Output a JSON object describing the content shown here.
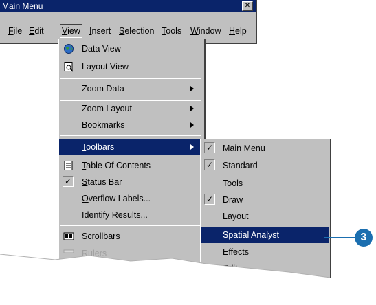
{
  "window": {
    "title": "Main Menu",
    "close_glyph": "✕"
  },
  "menubar": [
    {
      "label": "File",
      "u": "F",
      "rest": "ile"
    },
    {
      "label": "Edit",
      "u": "E",
      "rest": "dit"
    },
    {
      "label": "View",
      "u": "V",
      "rest": "iew"
    },
    {
      "label": "Insert",
      "u": "I",
      "rest": "nsert"
    },
    {
      "label": "Selection",
      "u": "S",
      "rest": "election"
    },
    {
      "label": "Tools",
      "u": "T",
      "rest": "ools"
    },
    {
      "label": "Window",
      "u": "W",
      "rest": "indow"
    },
    {
      "label": "Help",
      "u": "H",
      "rest": "elp"
    }
  ],
  "view_menu": {
    "data_view": "Data View",
    "layout_view": "Layout View",
    "zoom_data": "Zoom Data",
    "zoom_layout": "Zoom Layout",
    "bookmarks": "Bookmarks",
    "toolbars_u": "T",
    "toolbars_rest": "oolbars",
    "toc_u": "T",
    "toc_rest": "able Of Contents",
    "status_u": "S",
    "status_rest": "tatus Bar",
    "overflow_u": "O",
    "overflow_rest": "verflow Labels...",
    "identify": "Identify Results...",
    "scrollbars": "Scrollbars",
    "rulers": "Rulers"
  },
  "toolbars_menu": {
    "main_menu": "Main Menu",
    "standard": "Standard",
    "tools": "Tools",
    "draw": "Draw",
    "layout": "Layout",
    "spatial_analyst": "Spatial Analyst",
    "effects": "Effects",
    "editor": "Editor"
  },
  "check_glyph": "✓",
  "callout": {
    "number": "3",
    "color": "#1b6fb0"
  },
  "colors": {
    "menu_bg": "#c0c0c0",
    "highlight": "#0a246a"
  }
}
